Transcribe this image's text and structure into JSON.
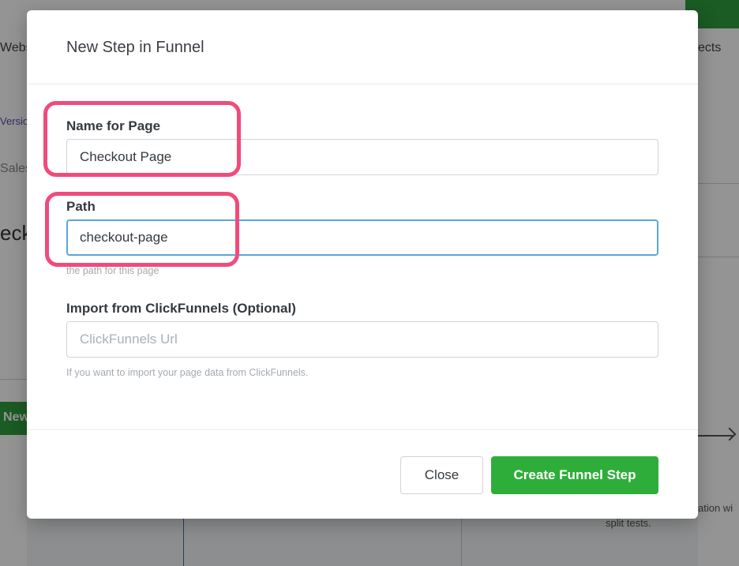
{
  "background": {
    "tab_left_partial": "Websi",
    "tab_right_partial": "ects",
    "link_left_partial": "Versio",
    "item_left_partial": "Sales",
    "heading_left_partial": "eck",
    "new_button_partial": "New",
    "right_text_partial": "ation wi",
    "split_tests_text": "split tests."
  },
  "modal": {
    "title": "New Step in Funnel",
    "fields": {
      "name": {
        "label": "Name for Page",
        "value": "Checkout Page"
      },
      "path": {
        "label": "Path",
        "value": "checkout-page",
        "help": "the path for this page"
      },
      "import": {
        "label": "Import from ClickFunnels (Optional)",
        "placeholder": "ClickFunnels Url",
        "help": "If you want to import your page data from ClickFunnels."
      }
    },
    "buttons": {
      "close": "Close",
      "create": "Create Funnel Step"
    }
  },
  "colors": {
    "highlight": "#f04b7b",
    "primary_button": "#2fad3a",
    "focus_border": "#5aa6d9"
  }
}
